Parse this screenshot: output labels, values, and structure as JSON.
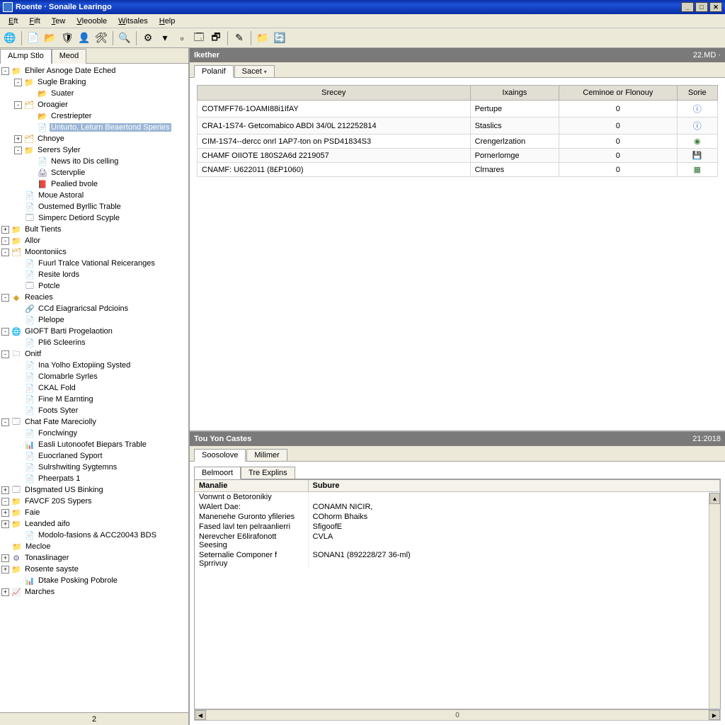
{
  "title": "Roente · Sonaile Learingo",
  "menu": [
    "Eft",
    "Fift",
    "Tew",
    "Vleooble",
    "Witsales",
    "Help"
  ],
  "toolbar_icons": [
    "globe-icon",
    "divider",
    "new-icon",
    "open-icon",
    "shield-icon",
    "user-icon",
    "tool-icon",
    "divider",
    "search-icon",
    "divider",
    "gear-icon",
    "dropdown-icon",
    "blank-icon",
    "window-icon",
    "window2-icon",
    "divider",
    "edit-icon",
    "divider",
    "folder-icon",
    "refresh-icon"
  ],
  "sidebar": {
    "tabs": [
      "ALmp Stlo",
      "Meod"
    ],
    "status": "2",
    "rows": [
      {
        "depth": 0,
        "exp": "-",
        "ico": "📁",
        "cls": "folder-ico",
        "label": "Ehiler Asnoge Date Eched"
      },
      {
        "depth": 1,
        "exp": "-",
        "ico": "📁",
        "cls": "folder-ico",
        "label": "Sugle Braking"
      },
      {
        "depth": 2,
        "exp": "",
        "ico": "📂",
        "cls": "folder-ico",
        "label": "Suater"
      },
      {
        "depth": 1,
        "exp": "-",
        "ico": "🗂",
        "cls": "folder-ico",
        "label": "Oroagier"
      },
      {
        "depth": 2,
        "exp": "",
        "ico": "📂",
        "cls": "folder-ico",
        "label": "Crestriepter"
      },
      {
        "depth": 2,
        "exp": "",
        "ico": "📄",
        "cls": "page-ico",
        "label": "Unturto, Leturn Beaertond Speries",
        "selected": true
      },
      {
        "depth": 1,
        "exp": "+",
        "ico": "🗂",
        "cls": "folder-ico",
        "label": "Chnoye"
      },
      {
        "depth": 1,
        "exp": "-",
        "ico": "📁",
        "cls": "folder-ico",
        "label": "Serers Syler"
      },
      {
        "depth": 2,
        "exp": "",
        "ico": "📄",
        "cls": "page-ico",
        "label": "News ito Dis celling"
      },
      {
        "depth": 2,
        "exp": "",
        "ico": "🖨",
        "cls": "page-ico",
        "label": "Sctervplie"
      },
      {
        "depth": 2,
        "exp": "",
        "ico": "📕",
        "cls": "folder-ico",
        "label": "Pealied bvole"
      },
      {
        "depth": 1,
        "exp": "",
        "ico": "📄",
        "cls": "page-ico",
        "label": "Moue Astoral"
      },
      {
        "depth": 1,
        "exp": "",
        "ico": "📄",
        "cls": "page-ico",
        "label": "Oustemed Byrllic Trable"
      },
      {
        "depth": 1,
        "exp": "",
        "ico": "🗔",
        "cls": "page-ico",
        "label": "Simperc Detiord Scyple"
      },
      {
        "depth": 0,
        "exp": "+",
        "ico": "📁",
        "cls": "folder-ico",
        "label": "Bult Tients"
      },
      {
        "depth": 0,
        "exp": "-",
        "ico": "📁",
        "cls": "folder-ico",
        "label": "Allor"
      },
      {
        "depth": 0,
        "exp": "-",
        "ico": "🗂",
        "cls": "folder-ico",
        "label": "Moontoniics"
      },
      {
        "depth": 1,
        "exp": "",
        "ico": "📄",
        "cls": "page-ico",
        "label": "Fuurl Tralce Vational Reiceranges"
      },
      {
        "depth": 1,
        "exp": "",
        "ico": "📄",
        "cls": "page-ico",
        "label": "Resite lords"
      },
      {
        "depth": 1,
        "exp": "",
        "ico": "🗔",
        "cls": "page-ico",
        "label": "Potcle"
      },
      {
        "depth": 0,
        "exp": "-",
        "ico": "◆",
        "cls": "folder-ico",
        "label": "Reacies"
      },
      {
        "depth": 1,
        "exp": "",
        "ico": "🔗",
        "cls": "page-ico",
        "label": "CCd Eiagraricsal Pdcioins"
      },
      {
        "depth": 1,
        "exp": "",
        "ico": "📄",
        "cls": "page-ico",
        "label": "Plelope"
      },
      {
        "depth": 0,
        "exp": "-",
        "ico": "🌐",
        "cls": "page-ico",
        "label": "GIOFT Barti Progelaotion"
      },
      {
        "depth": 1,
        "exp": "",
        "ico": "📄",
        "cls": "page-ico",
        "label": "Pli6 Scleerins"
      },
      {
        "depth": 0,
        "exp": "-",
        "ico": "🗀",
        "cls": "page-ico",
        "label": "Onitf"
      },
      {
        "depth": 1,
        "exp": "",
        "ico": "📄",
        "cls": "page-ico",
        "label": "Ina Yolho Extopiing Systed"
      },
      {
        "depth": 1,
        "exp": "",
        "ico": "📄",
        "cls": "page-ico",
        "label": "Clomabrle Syrles"
      },
      {
        "depth": 1,
        "exp": "",
        "ico": "📄",
        "cls": "page-ico",
        "label": "CKAL Fold"
      },
      {
        "depth": 1,
        "exp": "",
        "ico": "📄",
        "cls": "page-ico",
        "label": "Fine M Earnting"
      },
      {
        "depth": 1,
        "exp": "",
        "ico": "📄",
        "cls": "page-ico",
        "label": "Foots Syter"
      },
      {
        "depth": 0,
        "exp": "-",
        "ico": "🗔",
        "cls": "page-ico",
        "label": "Chat Fate Mareciolly"
      },
      {
        "depth": 1,
        "exp": "",
        "ico": "📄",
        "cls": "page-ico",
        "label": "Fonclwingy"
      },
      {
        "depth": 1,
        "exp": "",
        "ico": "📊",
        "cls": "page-ico",
        "label": "Easli Lutonoofet Biepars Trable"
      },
      {
        "depth": 1,
        "exp": "",
        "ico": "📄",
        "cls": "page-ico",
        "label": "Euocrlaned Syport"
      },
      {
        "depth": 1,
        "exp": "",
        "ico": "📄",
        "cls": "page-ico",
        "label": "Sulrshwiting Sygtemns"
      },
      {
        "depth": 1,
        "exp": "",
        "ico": "📄",
        "cls": "page-ico",
        "label": "Pheerpats 1"
      },
      {
        "depth": 0,
        "exp": "+",
        "ico": "🗔",
        "cls": "page-ico",
        "label": "DIsgmated US Binking"
      },
      {
        "depth": 0,
        "exp": "-",
        "ico": "📁",
        "cls": "folder-ico",
        "label": "FAVCF 20S Sypers"
      },
      {
        "depth": 0,
        "exp": "+",
        "ico": "📁",
        "cls": "folder-ico",
        "label": "Faie"
      },
      {
        "depth": 0,
        "exp": "+",
        "ico": "📁",
        "cls": "folder-ico",
        "label": "Leanded aifo"
      },
      {
        "depth": 1,
        "exp": "",
        "ico": "📄",
        "cls": "page-ico",
        "label": "Modolo-fasions & ACC20043 BDS"
      },
      {
        "depth": 0,
        "exp": "",
        "ico": "📁",
        "cls": "folder-ico",
        "label": "Mecloe"
      },
      {
        "depth": 0,
        "exp": "+",
        "ico": "⚙",
        "cls": "page-ico",
        "label": "Tonaslinager"
      },
      {
        "depth": 0,
        "exp": "+",
        "ico": "📁",
        "cls": "folder-ico",
        "label": "Rosente sayste"
      },
      {
        "depth": 1,
        "exp": "",
        "ico": "📊",
        "cls": "page-ico",
        "label": "Dtake Posking Pobrole"
      },
      {
        "depth": 0,
        "exp": "+",
        "ico": "📈",
        "cls": "folder-ico",
        "label": "Marches"
      }
    ]
  },
  "upper": {
    "title": "Ikether",
    "title_right": "22.MD ·",
    "tabs": [
      {
        "label": "Polanif",
        "active": true
      },
      {
        "label": "Sacet",
        "active": false,
        "dropdown": true
      }
    ],
    "columns": [
      "Srecey",
      "Ixaings",
      "Ceminoe or Flonouy",
      "Sorie"
    ],
    "rows": [
      {
        "c0": "COTMFF76-1OAMI88i1IfAY",
        "c1": "Pertupe",
        "c2": "0",
        "c3": "info"
      },
      {
        "c0": "CRA1-1S74- Getcomabico ABDI 34/0L 212252814",
        "c1": "Staslics",
        "c2": "0",
        "c3": "info"
      },
      {
        "c0": "CIM-1S74--dercc onrl 1AP7-ton on PSD41834S3",
        "c1": "Crengerlzation",
        "c2": "0",
        "c3": "soft"
      },
      {
        "c0": "CHAMF OIIOTE 180S2A6d 2219057",
        "c1": "Pornerlomge",
        "c2": "0",
        "c3": "save"
      },
      {
        "c0": "CNAMF: U622011 (8£P1060)",
        "c1": "Clrnares",
        "c2": "0",
        "c3": "excel"
      }
    ]
  },
  "lower": {
    "title": "Tou Yon Castes",
    "title_right": "21:2018",
    "tabs": [
      {
        "label": "Soosolove",
        "active": true
      },
      {
        "label": "Milimer",
        "active": false
      }
    ],
    "inner_tabs": [
      {
        "label": "Belmoort",
        "active": true
      },
      {
        "label": "Tre Explins",
        "active": false
      }
    ],
    "columns": [
      "Manalie",
      "Subure"
    ],
    "rows": [
      {
        "k": "Vonwnt o Betoronikiy",
        "v": ""
      },
      {
        "k": "WAlert Dae:",
        "v": "CONAMN NICIR,"
      },
      {
        "k": "Manenehe Guronto yfileries",
        "v": "COhorm Bhaiks"
      },
      {
        "k": "Fased lavl ten pelraanlierri",
        "v": "SfigoofE"
      },
      {
        "k": "Nerevcher E6lirafonott Seesing",
        "v": "CVLA"
      },
      {
        "k": "Seternalie Componer f Sprrivuy",
        "v": "SONAN1 (892228/27 36-ml)"
      }
    ],
    "hscroll": "0"
  },
  "glyphs": {
    "globe-icon": "🌐",
    "new-icon": "📄",
    "open-icon": "📂",
    "shield-icon": "🛡",
    "user-icon": "👤",
    "tool-icon": "🛠",
    "search-icon": "🔍",
    "gear-icon": "⚙",
    "dropdown-icon": "▾",
    "blank-icon": "▫",
    "window-icon": "🗔",
    "window2-icon": "🗗",
    "edit-icon": "✎",
    "folder-icon": "📁",
    "refresh-icon": "🔄",
    "info": "ⓘ",
    "save": "💾",
    "excel": "▦",
    "soft": "◉"
  }
}
